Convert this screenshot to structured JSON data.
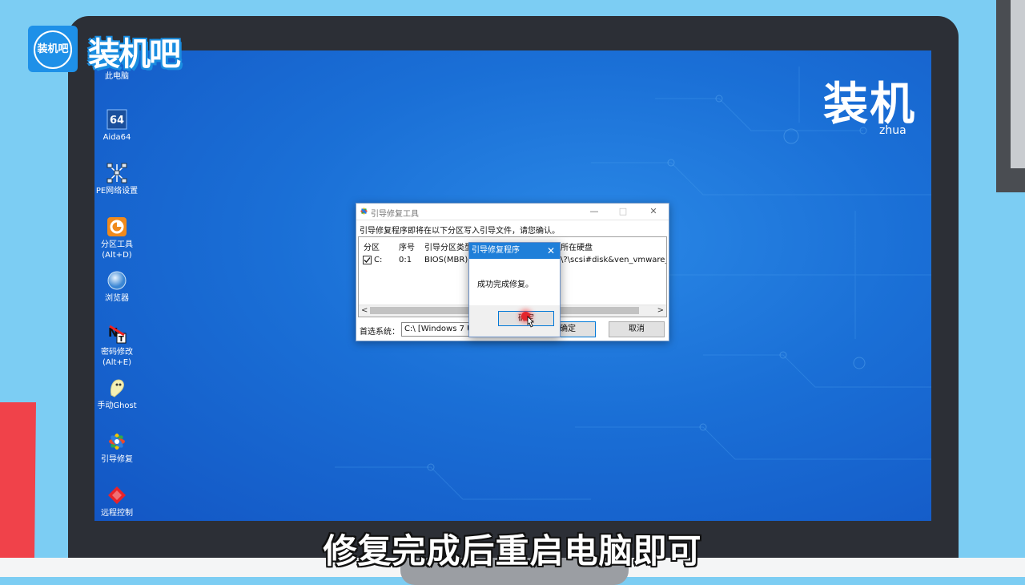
{
  "branding": {
    "logo_badge_text": "装机吧",
    "logo_text": "装机吧",
    "watermark_text": "装机",
    "watermark_sub": "zhua"
  },
  "desktop_icons": [
    {
      "label": "此电脑",
      "icon": "computer-icon"
    },
    {
      "label": "Aida64",
      "icon": "aida64-icon"
    },
    {
      "label": "PE网络设置",
      "icon": "network-icon"
    },
    {
      "label": "分区工具\n(Alt+D)",
      "line1": "分区工具",
      "line2": "(Alt+D)",
      "icon": "partition-tool-icon"
    },
    {
      "label": "浏览器",
      "icon": "browser-icon"
    },
    {
      "label": "密码修改\n(Alt+E)",
      "line1": "密码修改",
      "line2": "(Alt+E)",
      "icon": "password-icon"
    },
    {
      "label": "手动Ghost",
      "icon": "ghost-icon"
    },
    {
      "label": "引导修复",
      "icon": "boot-repair-icon"
    },
    {
      "label": "远程控制",
      "icon": "remote-control-icon"
    }
  ],
  "boot_tool_window": {
    "title": "引导修复工具",
    "instruction": "引导修复程序即将在以下分区写入引导文件，请您确认。",
    "columns": [
      "分区",
      "序号",
      "引导分区类型",
      "所在硬盘"
    ],
    "rows": [
      {
        "checked": true,
        "partition": "C:",
        "index": "0:1",
        "type": "BIOS(MBR)",
        "disk": "\\?\\scsi#disk&ven_vmware_&"
      }
    ],
    "preferred_system_label": "首选系统：",
    "preferred_system_value": "C:\\ [Windows 7 U",
    "ok_label": "确定",
    "cancel_label": "取消"
  },
  "message_box": {
    "title": "引导修复程序",
    "message": "成功完成修复。",
    "ok_label": "确定"
  },
  "caption": "修复完成后重启电脑即可",
  "colors": {
    "desktop_blue": "#1a6fd6",
    "title_blue": "#1f7fd9",
    "accent_red": "#f0424a",
    "background_sky": "#7ccdf3"
  }
}
